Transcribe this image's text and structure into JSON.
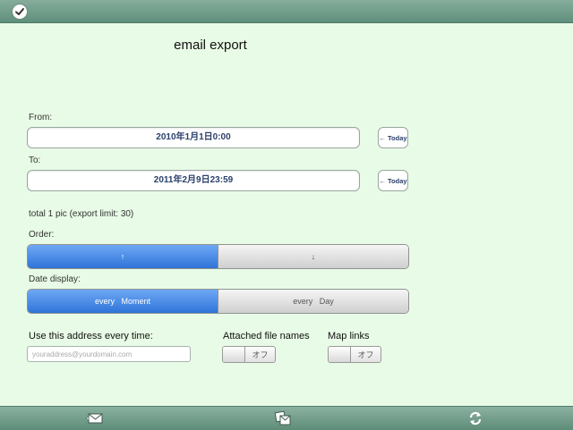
{
  "header": {
    "done_icon": "checkmark-circle-icon"
  },
  "title": "email export",
  "from": {
    "label": "From:",
    "value": "2010年1月1日0:00",
    "today_label": "← Today"
  },
  "to": {
    "label": "To:",
    "value": "2011年2月9日23:59",
    "today_label": "← Today"
  },
  "total_text": "total 1 pic (export limit: 30)",
  "order": {
    "label": "Order:",
    "ascending": "↑",
    "descending": "↓",
    "selected": "ascending"
  },
  "date_display": {
    "label": "Date display:",
    "moment": "every   Moment",
    "day": "every   Day",
    "selected": "moment"
  },
  "address": {
    "label": "Use this address every time:",
    "placeholder": "youraddress@yourdomain.com",
    "value": ""
  },
  "attached_file_names": {
    "label": "Attached file names",
    "state": "オフ"
  },
  "map_links": {
    "label": "Map links",
    "state": "オフ"
  },
  "toolbar": {
    "icons": [
      "envelope-icon",
      "photos-share-icon",
      "refresh-icon"
    ]
  },
  "colors": {
    "accent": "#2f74d8",
    "background": "#e8fbe6",
    "bar": "#6e9c89"
  }
}
